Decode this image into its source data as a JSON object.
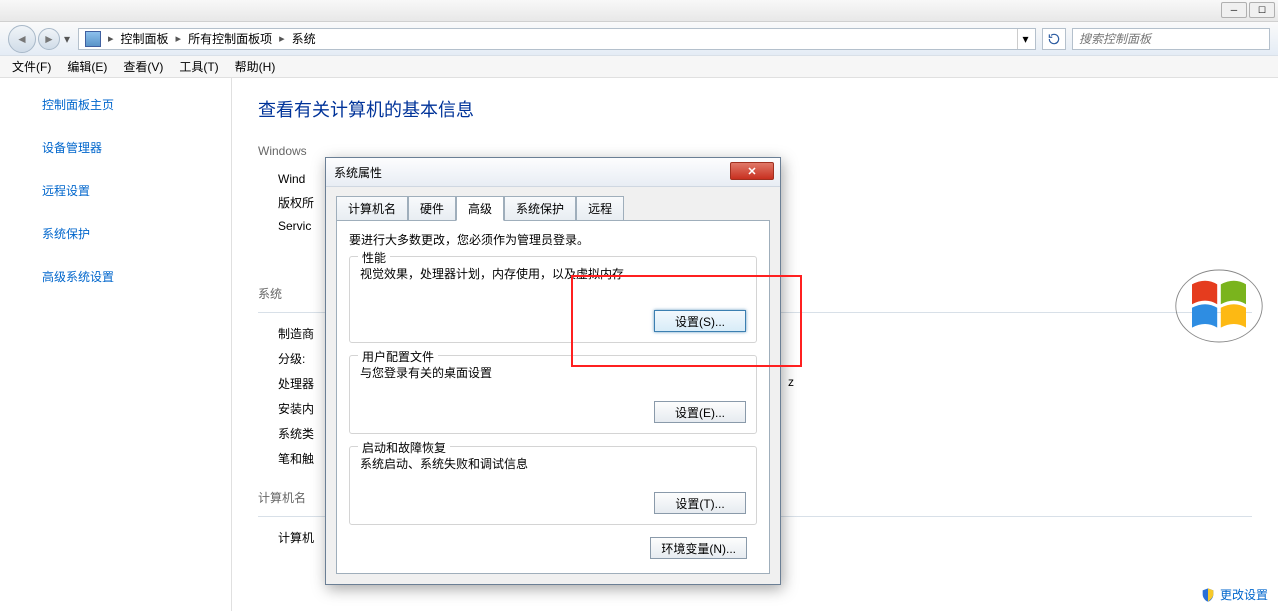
{
  "breadcrumb": {
    "item1": "控制面板",
    "item2": "所有控制面板项",
    "item3": "系统"
  },
  "search": {
    "placeholder": "搜索控制面板"
  },
  "menubar": {
    "file": "文件(F)",
    "edit": "编辑(E)",
    "view": "查看(V)",
    "tools": "工具(T)",
    "help": "帮助(H)"
  },
  "sidebar": {
    "home": "控制面板主页",
    "devmgr": "设备管理器",
    "remote": "远程设置",
    "sysprotect": "系统保护",
    "advanced": "高级系统设置"
  },
  "main": {
    "title": "查看有关计算机的基本信息",
    "sec_win": "Windows",
    "ver_label": "Wind",
    "copyright": "版权所",
    "sp": "Servic",
    "sec_sys": "系统",
    "mfr": "制造商",
    "rating": "分级:",
    "cpu": "处理器",
    "mem": "安装内",
    "systype": "系统类",
    "pen": "笔和触",
    "sec_pcname": "计算机名",
    "pcname_row": "计算机",
    "hz_suffix": "z"
  },
  "dialog": {
    "title": "系统属性",
    "tabs": {
      "t1": "计算机名",
      "t2": "硬件",
      "t3": "高级",
      "t4": "系统保护",
      "t5": "远程"
    },
    "admin_note": "要进行大多数更改，您必须作为管理员登录。",
    "perf": {
      "title": "性能",
      "desc": "视觉效果，处理器计划，内存使用，以及虚拟内存",
      "btn": "设置(S)..."
    },
    "profile": {
      "title": "用户配置文件",
      "desc": "与您登录有关的桌面设置",
      "btn": "设置(E)..."
    },
    "startup": {
      "title": "启动和故障恢复",
      "desc": "系统启动、系统失败和调试信息",
      "btn": "设置(T)..."
    },
    "env_btn": "环境变量(N)..."
  },
  "footer": {
    "change": "更改设置"
  }
}
